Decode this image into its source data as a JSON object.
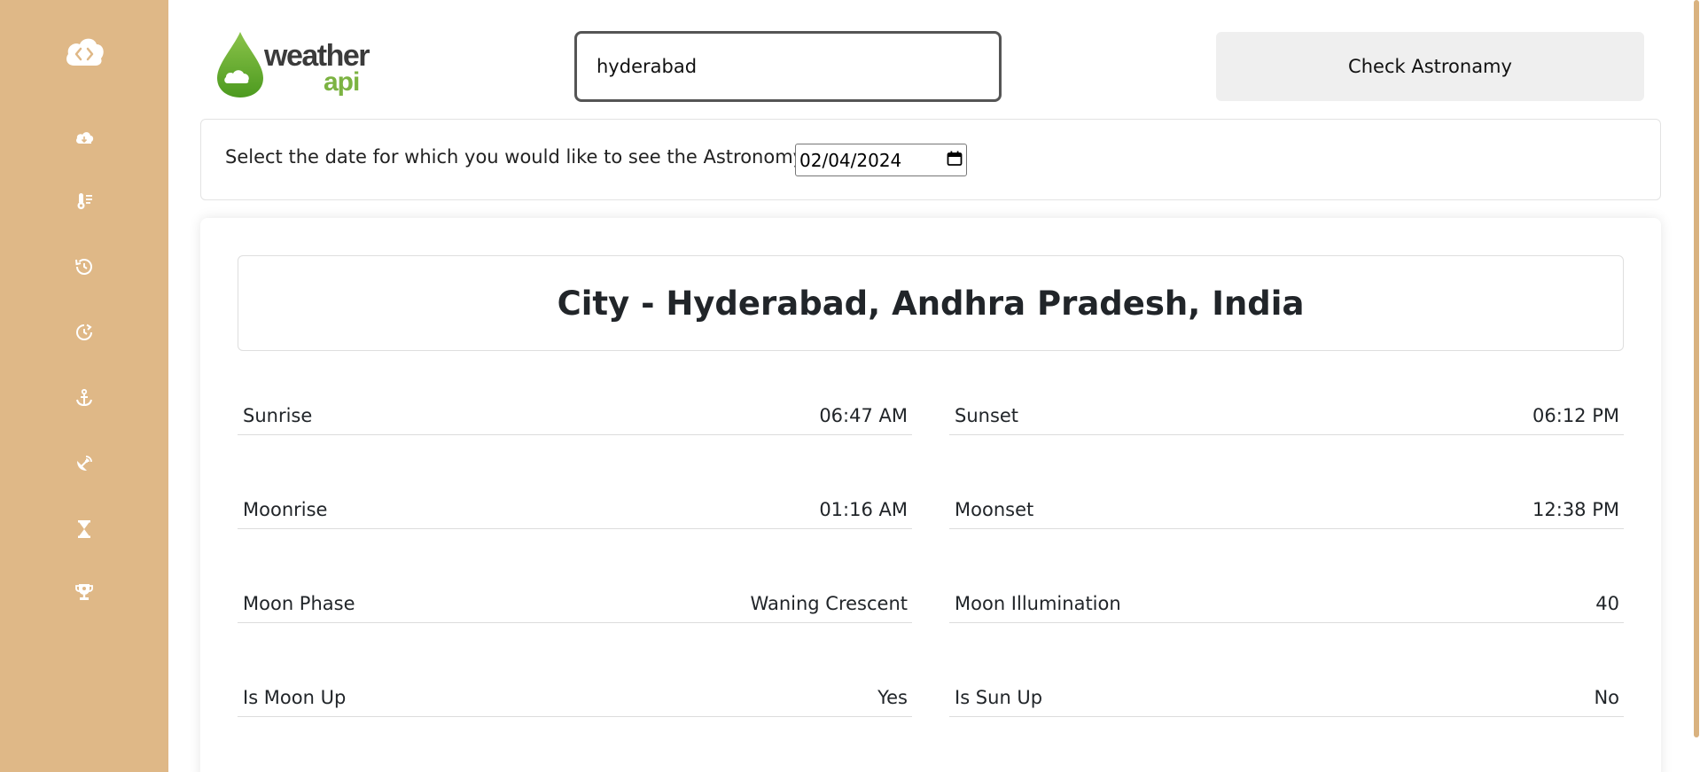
{
  "sidebar": {
    "items": [
      {
        "icon": "cloud-download-icon"
      },
      {
        "icon": "thermometer-icon"
      },
      {
        "icon": "history-icon"
      },
      {
        "icon": "future-clock-icon"
      },
      {
        "icon": "anchor-icon"
      },
      {
        "icon": "satellite-dish-icon"
      },
      {
        "icon": "hourglass-icon"
      },
      {
        "icon": "trophy-icon"
      }
    ],
    "color": "#dfb887"
  },
  "header": {
    "brand_word1": "weather",
    "brand_word2": "api",
    "search_value": "hyderabad",
    "check_button": "Check Astronamy"
  },
  "date_picker": {
    "label": "Select the date for which you would like to see the Astronomy.",
    "value": "02/04/2024"
  },
  "astronomy": {
    "city_title": "City - Hyderabad, Andhra Pradesh, India",
    "rows": [
      {
        "left_label": "Sunrise",
        "left_value": "06:47 AM",
        "right_label": "Sunset",
        "right_value": "06:12 PM"
      },
      {
        "left_label": "Moonrise",
        "left_value": "01:16 AM",
        "right_label": "Moonset",
        "right_value": "12:38 PM"
      },
      {
        "left_label": "Moon Phase",
        "left_value": "Waning Crescent",
        "right_label": "Moon Illumination",
        "right_value": "40"
      },
      {
        "left_label": "Is Moon Up",
        "left_value": "Yes",
        "right_label": "Is Sun Up",
        "right_value": "No"
      }
    ]
  }
}
